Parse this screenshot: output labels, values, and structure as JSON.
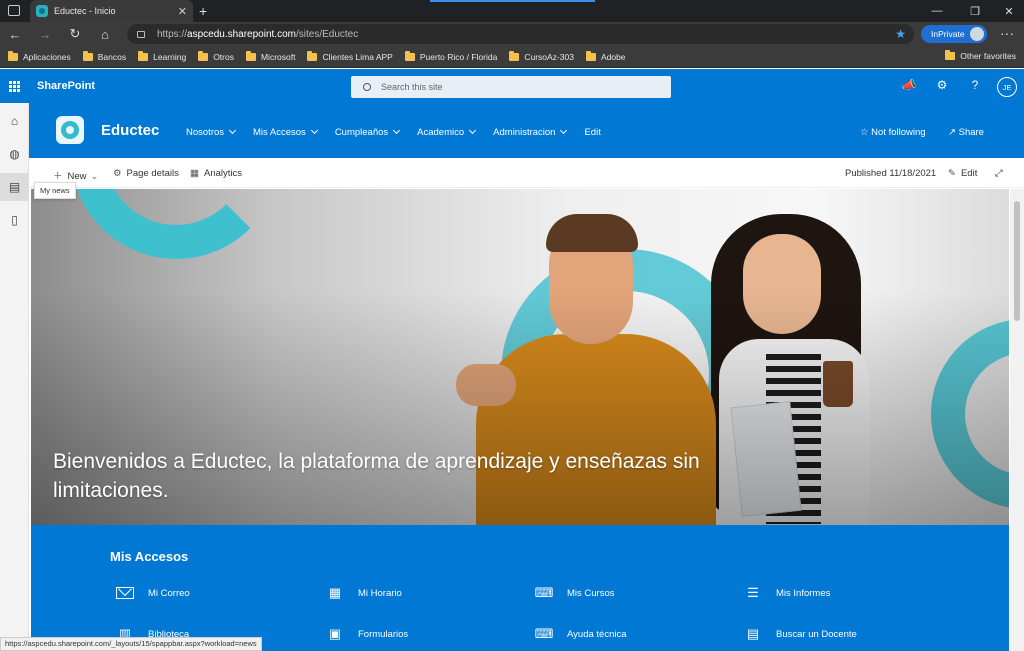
{
  "browser": {
    "tab_title": "Eductec - Inicio",
    "url_prefix": "https://",
    "url_domain": "aspcedu.sharepoint.com",
    "url_path": "/sites/Eductec",
    "inprivate_label": "InPrivate",
    "bookmarks": [
      "Aplicaciones",
      "Bancos",
      "Learning",
      "Otros",
      "Microsoft",
      "Clientes Lima APP",
      "Puerto Rico / Florida",
      "CursoAz-303",
      "Adobe"
    ],
    "other_favorites": "Other favorites"
  },
  "suite": {
    "app_name": "SharePoint",
    "search_placeholder": "Search this site",
    "user_initials": "JE"
  },
  "appbar": {
    "tooltip": "My news"
  },
  "site": {
    "name": "Eductec",
    "nav": [
      {
        "label": "Nosotros",
        "has_menu": true
      },
      {
        "label": "Mis Accesos",
        "has_menu": true
      },
      {
        "label": "Cumpleaños",
        "has_menu": true
      },
      {
        "label": "Academico",
        "has_menu": true
      },
      {
        "label": "Administracion",
        "has_menu": true
      },
      {
        "label": "Edit",
        "has_menu": false
      }
    ],
    "follow_label": "Not following",
    "share_label": "Share"
  },
  "commandbar": {
    "new_label": "New",
    "page_details_label": "Page details",
    "analytics_label": "Analytics",
    "published_label": "Published 11/18/2021",
    "edit_label": "Edit"
  },
  "hero": {
    "headline": "Bienvenidos a Eductec, la plataforma de aprendizaje y enseñazas sin limitaciones."
  },
  "quick_links": {
    "title": "Mis Accesos",
    "items": [
      {
        "label": "Mi Correo",
        "icon": "mail-icon"
      },
      {
        "label": "Mi Horario",
        "icon": "calendar-icon"
      },
      {
        "label": "Mis Cursos",
        "icon": "laptop-icon"
      },
      {
        "label": "Mis Informes",
        "icon": "list-icon"
      },
      {
        "label": "Biblioteca",
        "icon": "library-icon"
      },
      {
        "label": "Formularios",
        "icon": "forms-icon"
      },
      {
        "label": "Ayuda técnica",
        "icon": "laptop-icon"
      },
      {
        "label": "Buscar un Docente",
        "icon": "document-icon"
      }
    ]
  },
  "status_url": "https://aspcedu.sharepoint.com/_layouts/15/spappbar.aspx?workload=news",
  "colors": {
    "brand_blue": "#0078d4",
    "accent_teal": "#3fc0cf"
  }
}
